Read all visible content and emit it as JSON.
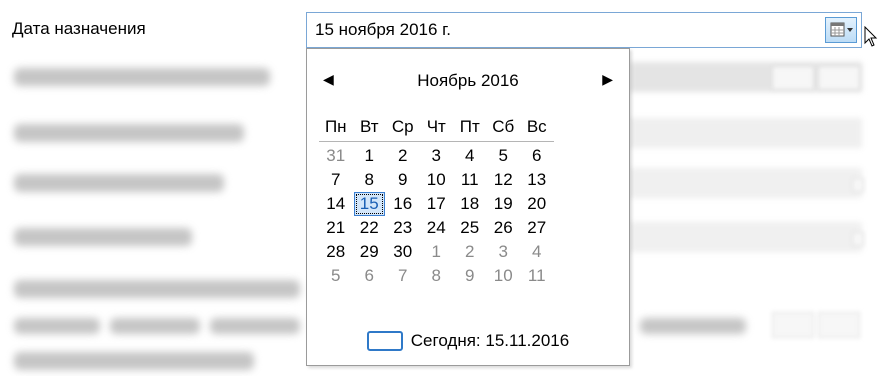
{
  "form": {
    "date_label": "Дата назначения",
    "date_value": "15  ноября   2016 г."
  },
  "calendar": {
    "month_title": "Ноябрь 2016",
    "prev_glyph": "◀",
    "next_glyph": "▶",
    "weekdays": [
      "Пн",
      "Вт",
      "Ср",
      "Чт",
      "Пт",
      "Сб",
      "Вс"
    ],
    "weeks": [
      [
        {
          "d": "31",
          "o": true
        },
        {
          "d": "1"
        },
        {
          "d": "2"
        },
        {
          "d": "3"
        },
        {
          "d": "4"
        },
        {
          "d": "5"
        },
        {
          "d": "6"
        }
      ],
      [
        {
          "d": "7"
        },
        {
          "d": "8"
        },
        {
          "d": "9"
        },
        {
          "d": "10"
        },
        {
          "d": "11"
        },
        {
          "d": "12"
        },
        {
          "d": "13"
        }
      ],
      [
        {
          "d": "14"
        },
        {
          "d": "15",
          "s": true
        },
        {
          "d": "16"
        },
        {
          "d": "17"
        },
        {
          "d": "18"
        },
        {
          "d": "19"
        },
        {
          "d": "20"
        }
      ],
      [
        {
          "d": "21"
        },
        {
          "d": "22"
        },
        {
          "d": "23"
        },
        {
          "d": "24"
        },
        {
          "d": "25"
        },
        {
          "d": "26"
        },
        {
          "d": "27"
        }
      ],
      [
        {
          "d": "28"
        },
        {
          "d": "29"
        },
        {
          "d": "30"
        },
        {
          "d": "1",
          "o": true
        },
        {
          "d": "2",
          "o": true
        },
        {
          "d": "3",
          "o": true
        },
        {
          "d": "4",
          "o": true
        }
      ],
      [
        {
          "d": "5",
          "o": true
        },
        {
          "d": "6",
          "o": true
        },
        {
          "d": "7",
          "o": true
        },
        {
          "d": "8",
          "o": true
        },
        {
          "d": "9",
          "o": true
        },
        {
          "d": "10",
          "o": true
        },
        {
          "d": "11",
          "o": true
        }
      ]
    ],
    "today_label": "Сегодня: 15.11.2016"
  },
  "colors": {
    "accent": "#3b7fd1",
    "selected_fill": "#d3e6fa",
    "other_month_text": "#8a8a8a"
  },
  "icons": {
    "calendar_dropdown": "calendar-icon",
    "cursor": "mouse-pointer-icon"
  }
}
